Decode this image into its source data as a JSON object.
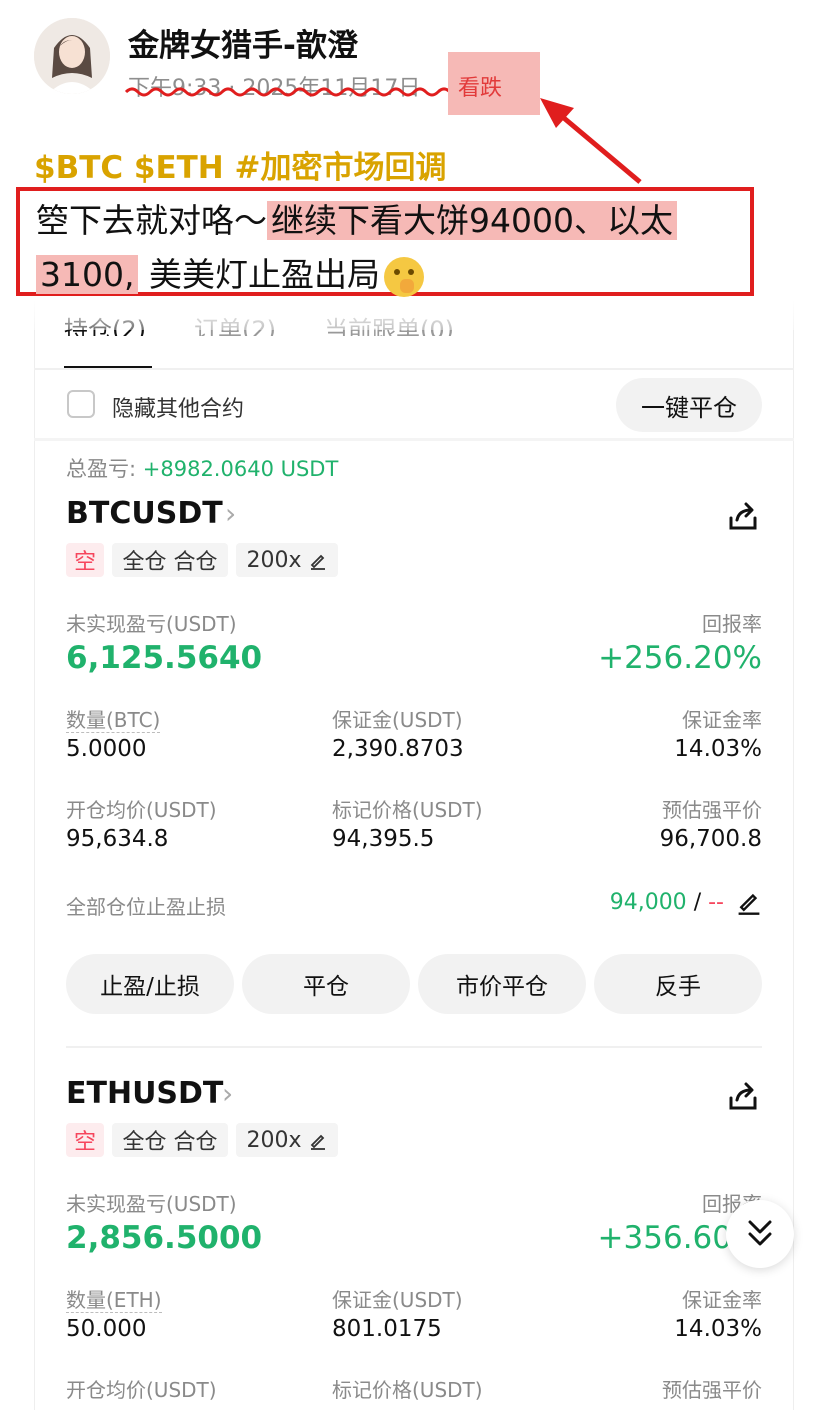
{
  "post": {
    "author": "金牌女猎手-歆澄",
    "timestamp": "下午9:33 · 2025年11月17日",
    "sentiment_tag": "看跌",
    "hashtags": "$BTC $ETH #加密市场回调",
    "body_part1": "箜下去就对咯～",
    "body_highlight1": "继续下看大饼94000、以太",
    "body_highlight2": "3100,",
    "body_part2": " 美美灯止盈出局"
  },
  "tabs": [
    "持仓(2)",
    "订单(2)",
    "当前跟单(0)"
  ],
  "controls": {
    "hide_other_label": "隐藏其他合约",
    "close_all_label": "一键平仓"
  },
  "total_pnl": {
    "label": "总盈亏:",
    "value": "+8982.0640 USDT"
  },
  "positions": [
    {
      "symbol": "BTCUSDT",
      "side": "空",
      "margin_mode": "全仓 合仓",
      "leverage": "200x",
      "unrealized_label": "未实现盈亏(USDT)",
      "unrealized_value": "6,125.5640",
      "roe_label": "回报率",
      "roe_value": "+256.20%",
      "qty_label": "数量(BTC)",
      "qty_value": "5.0000",
      "margin_label": "保证金(USDT)",
      "margin_value": "2,390.8703",
      "margin_ratio_label": "保证金率",
      "margin_ratio_value": "14.03%",
      "entry_label": "开仓均价(USDT)",
      "entry_value": "95,634.8",
      "mark_label": "标记价格(USDT)",
      "mark_value": "94,395.5",
      "liq_label": "预估强平价",
      "liq_value": "96,700.8",
      "tpsl_label": "全部仓位止盈止损",
      "tp_value": "94,000",
      "slash": "/",
      "sl_value": "--",
      "buttons": [
        "止盈/止损",
        "平仓",
        "市价平仓",
        "反手"
      ]
    },
    {
      "symbol": "ETHUSDT",
      "side": "空",
      "margin_mode": "全仓 合仓",
      "leverage": "200x",
      "unrealized_label": "未实现盈亏(USDT)",
      "unrealized_value": "2,856.5000",
      "roe_label": "回报率",
      "roe_value": "+356.60",
      "qty_label": "数量(ETH)",
      "qty_value": "50.000",
      "margin_label": "保证金(USDT)",
      "margin_value": "801.0175",
      "margin_ratio_label": "保证金率",
      "margin_ratio_value": "14.03%",
      "entry_label": "开仓均价(USDT)",
      "mark_label": "标记价格(USDT)",
      "liq_label": "预估强平价"
    }
  ],
  "colors": {
    "profit": "#20b26c",
    "loss": "#f6465d",
    "annotation": "#e01e1e",
    "hashtag": "#d9a300"
  }
}
